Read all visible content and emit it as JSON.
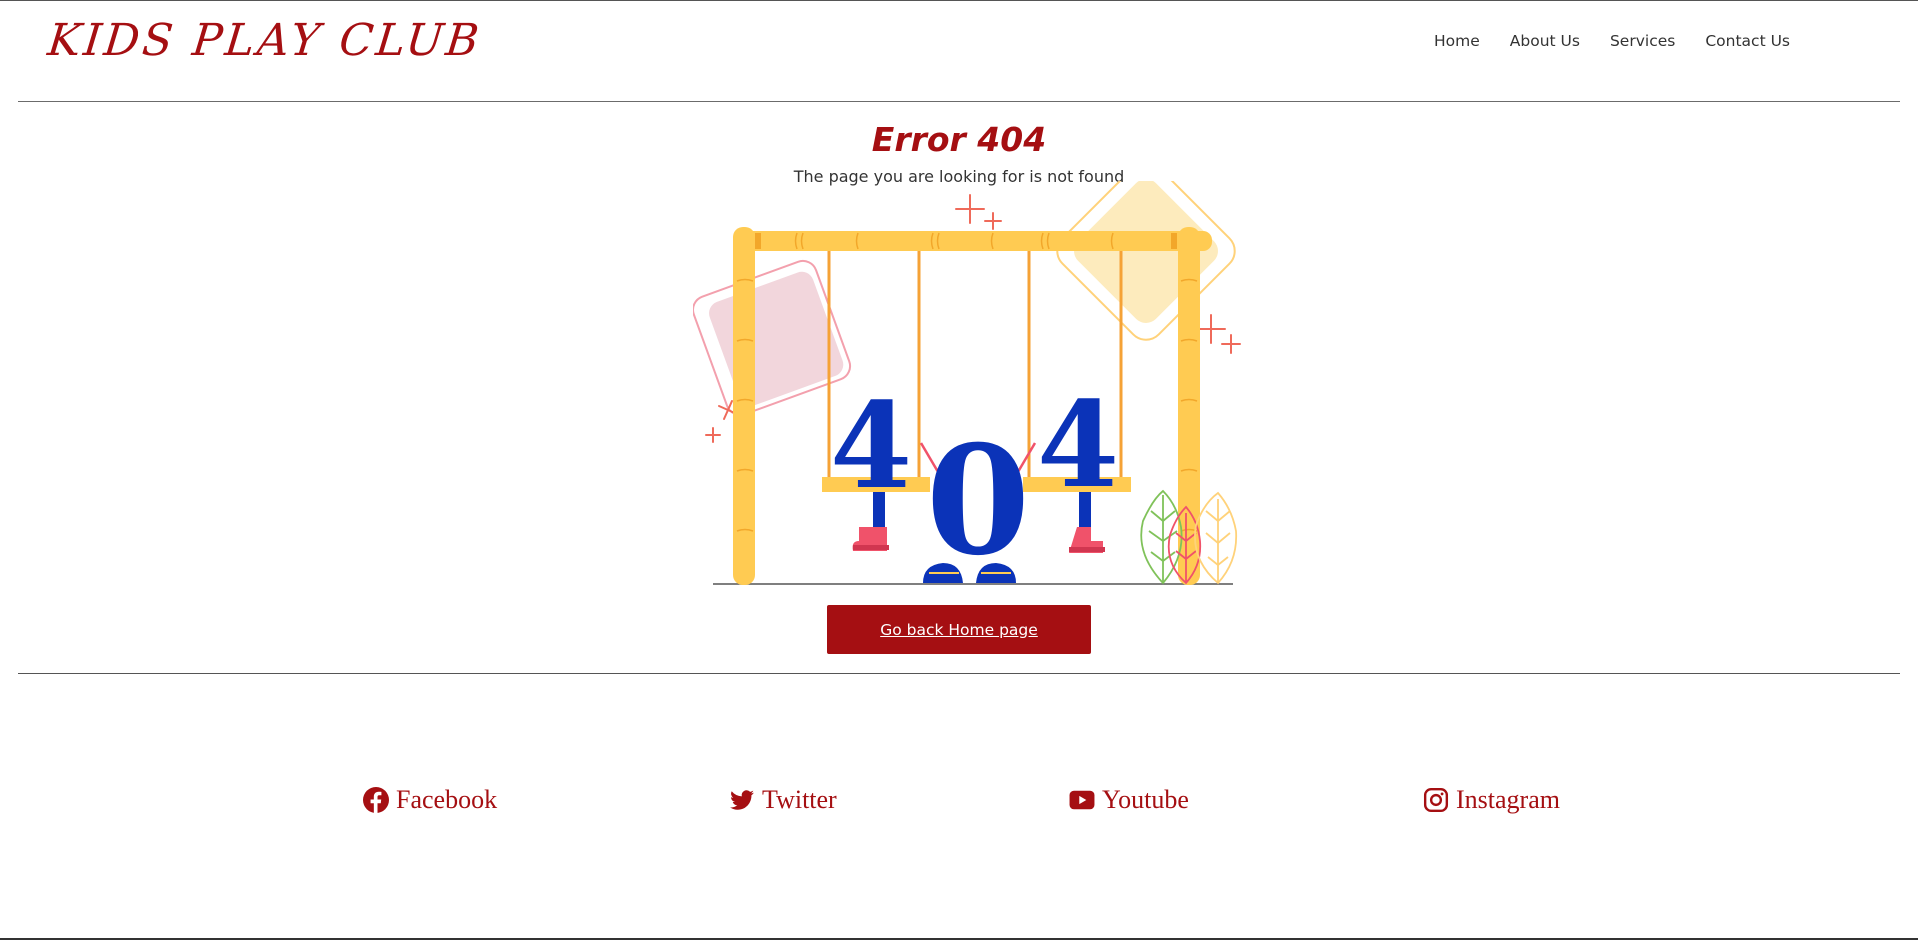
{
  "brand": {
    "name": "KIDS PLAY CLUB"
  },
  "nav": {
    "items": [
      {
        "label": "Home"
      },
      {
        "label": "About Us"
      },
      {
        "label": "Services"
      },
      {
        "label": "Contact Us"
      }
    ]
  },
  "error": {
    "title": "Error 404",
    "message": "The page you are looking for is not found",
    "illustration_text": "404",
    "button_label": "Go back Home page"
  },
  "social": [
    {
      "label": "Facebook",
      "icon": "facebook-icon"
    },
    {
      "label": "Twitter",
      "icon": "twitter-icon"
    },
    {
      "label": "Youtube",
      "icon": "youtube-icon"
    },
    {
      "label": "Instagram",
      "icon": "instagram-icon"
    }
  ],
  "colors": {
    "brand_red": "#a50f12",
    "swing_yellow": "#ffcb52",
    "digit_blue": "#0b33b8",
    "boot_pink": "#f0526a"
  }
}
